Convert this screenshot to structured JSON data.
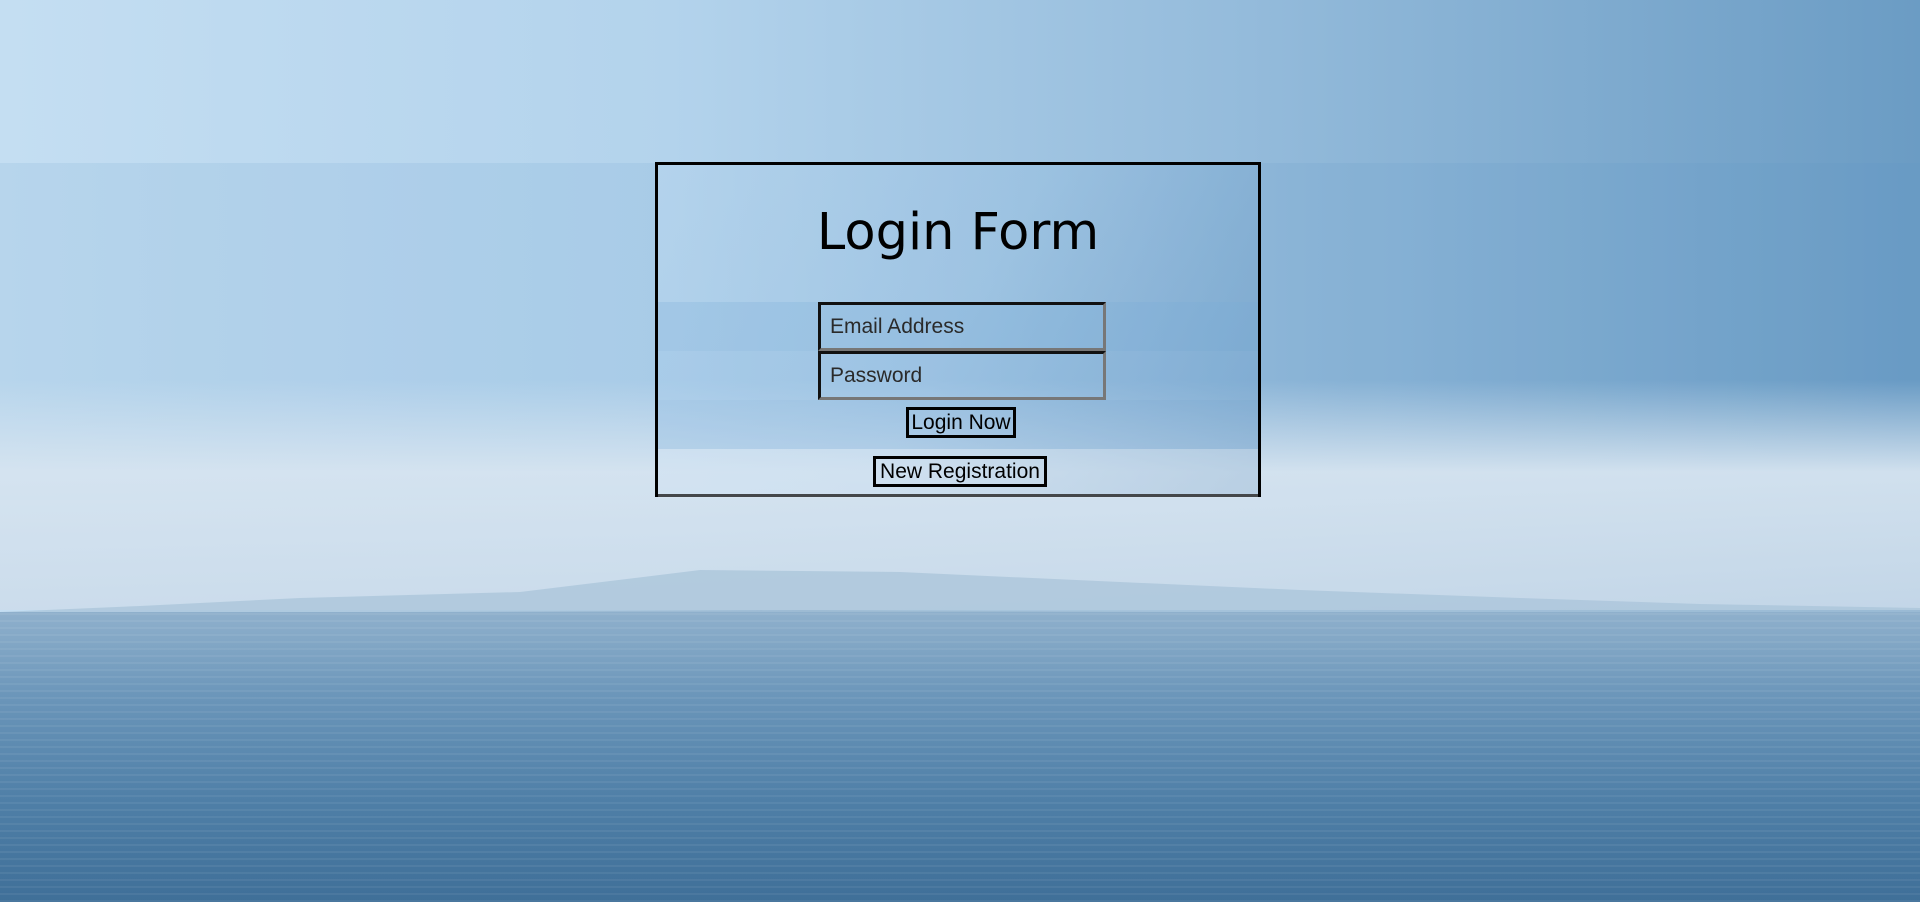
{
  "login_form": {
    "title": "Login Form",
    "email": {
      "placeholder": "Email Address",
      "value": ""
    },
    "password": {
      "placeholder": "Password",
      "value": ""
    },
    "login_button_label": "Login Now",
    "register_button_label": "New Registration"
  },
  "colors": {
    "border": "#000000",
    "sky_left": "#c4def2",
    "sky_right": "#6b9cc4",
    "sea": "#4f7fa7"
  }
}
